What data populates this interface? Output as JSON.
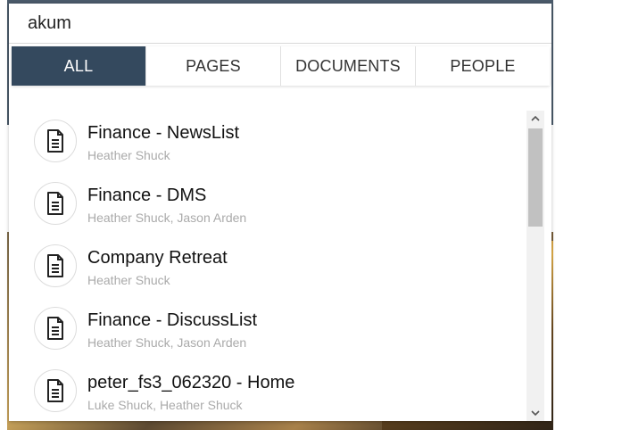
{
  "search": {
    "query": "akum"
  },
  "tabs": [
    {
      "label": "ALL",
      "active": true
    },
    {
      "label": "PAGES",
      "active": false
    },
    {
      "label": "DOCUMENTS",
      "active": false
    },
    {
      "label": "PEOPLE",
      "active": false
    }
  ],
  "results": [
    {
      "icon": "document-icon",
      "title": "Finance - NewsList",
      "people": "Heather Shuck"
    },
    {
      "icon": "document-icon",
      "title": "Finance - DMS",
      "people": "Heather Shuck, Jason Arden"
    },
    {
      "icon": "document-icon",
      "title": "Company Retreat",
      "people": "Heather Shuck"
    },
    {
      "icon": "document-icon",
      "title": "Finance - DiscussList",
      "people": "Heather Shuck, Jason Arden"
    },
    {
      "icon": "document-icon",
      "title": "peter_fs3_062320 - Home",
      "people": "Luke Shuck, Heather Shuck"
    }
  ],
  "colors": {
    "active_tab": "#34495e",
    "subtitle": "#aaaaaa"
  }
}
